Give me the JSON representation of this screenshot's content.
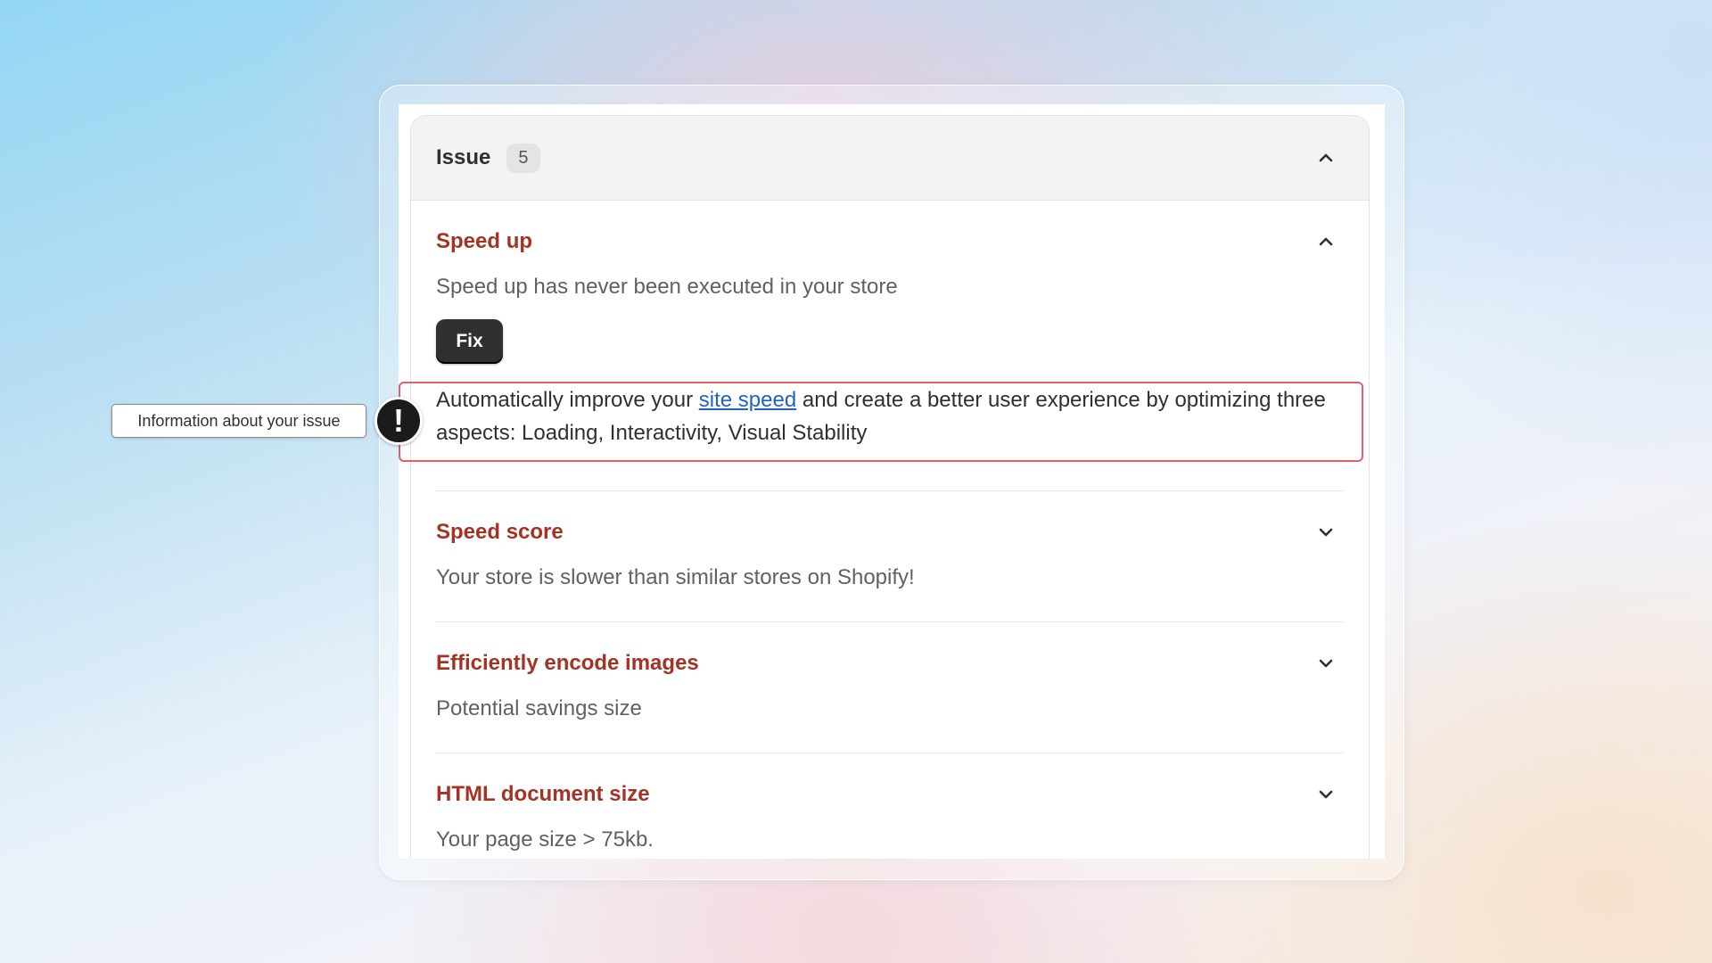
{
  "card": {
    "title": "Issue",
    "count": "5"
  },
  "sections": [
    {
      "title": "Speed up",
      "description": "Speed up has never been executed in your store",
      "expanded": true,
      "button_label": "Fix",
      "info": {
        "text_before": "Automatically improve your ",
        "link_text": "site speed",
        "text_after": " and create a better user experience by optimizing three aspects: Loading, Interactivity, Visual Stability"
      }
    },
    {
      "title": "Speed score",
      "description": "Your store is slower than similar stores on Shopify!",
      "expanded": false
    },
    {
      "title": "Efficiently encode images",
      "description": "Potential savings size",
      "expanded": false
    },
    {
      "title": "HTML document size",
      "description": "Your page size > 75kb.",
      "expanded": false
    }
  ],
  "annotation": {
    "tooltip": "Information about your issue",
    "icon": "exclamation-icon",
    "highlight_color": "#e35d6a"
  },
  "colors": {
    "section_title": "#a33325",
    "link": "#1f64c4",
    "button_bg": "#303030"
  }
}
